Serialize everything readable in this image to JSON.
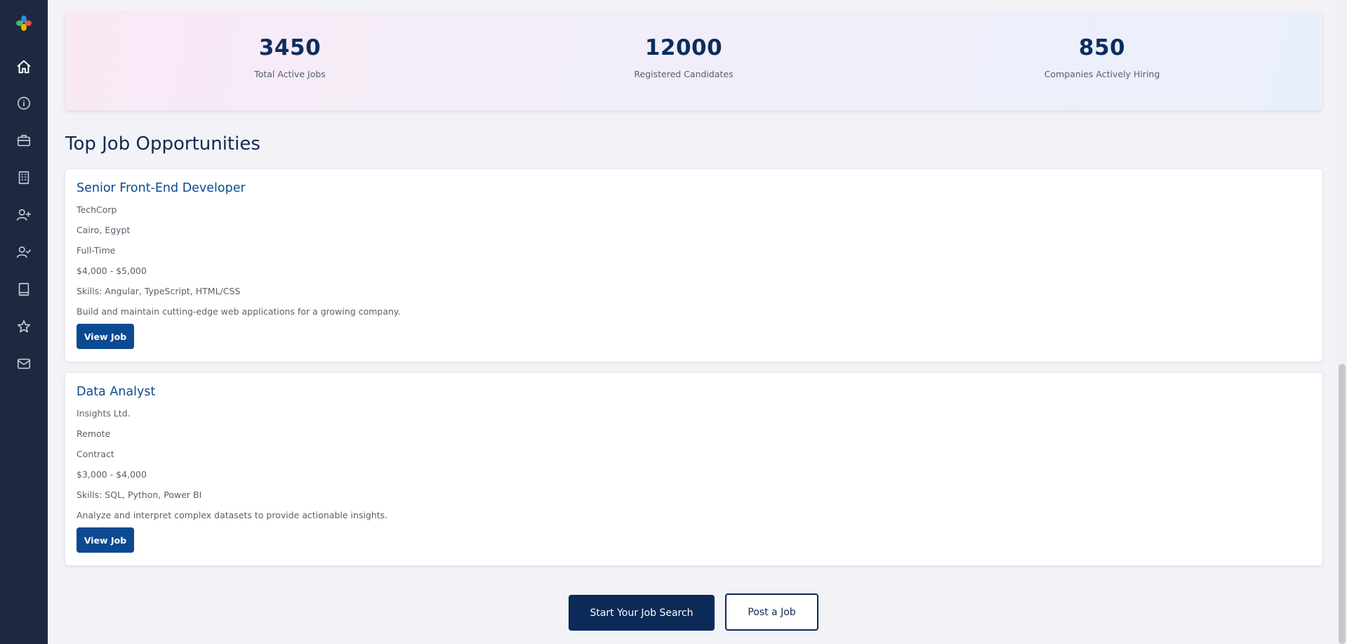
{
  "sidebar": {
    "logo_colors": [
      "#2f8de4",
      "#e8553d",
      "#4cb86b",
      "#f4b400"
    ],
    "items": [
      {
        "icon": "home-icon",
        "active": true
      },
      {
        "icon": "info-icon"
      },
      {
        "icon": "briefcase-icon"
      },
      {
        "icon": "building-icon"
      },
      {
        "icon": "user-plus-icon"
      },
      {
        "icon": "user-check-icon"
      },
      {
        "icon": "book-icon"
      },
      {
        "icon": "star-icon"
      },
      {
        "icon": "mail-icon"
      }
    ]
  },
  "stats": [
    {
      "value": "3450",
      "label": "Total Active Jobs"
    },
    {
      "value": "12000",
      "label": "Registered Candidates"
    },
    {
      "value": "850",
      "label": "Companies Actively Hiring"
    }
  ],
  "section_title": "Top Job Opportunities",
  "jobs": [
    {
      "title": "Senior Front-End Developer",
      "company": "TechCorp",
      "location": "Cairo, Egypt",
      "type": "Full-Time",
      "salary": "$4,000 - $5,000",
      "skills": "Skills: Angular, TypeScript, HTML/CSS",
      "description": "Build and maintain cutting-edge web applications for a growing company.",
      "button": "View Job"
    },
    {
      "title": "Data Analyst",
      "company": "Insights Ltd.",
      "location": "Remote",
      "type": "Contract",
      "salary": "$3,000 - $4,000",
      "skills": "Skills: SQL, Python, Power BI",
      "description": "Analyze and interpret complex datasets to provide actionable insights.",
      "button": "View Job"
    }
  ],
  "cta": {
    "primary": "Start Your Job Search",
    "secondary": "Post a Job"
  },
  "colors": {
    "sidebar_bg": "#1c2940",
    "accent": "#0b4a90",
    "heading": "#0c2d5e"
  }
}
